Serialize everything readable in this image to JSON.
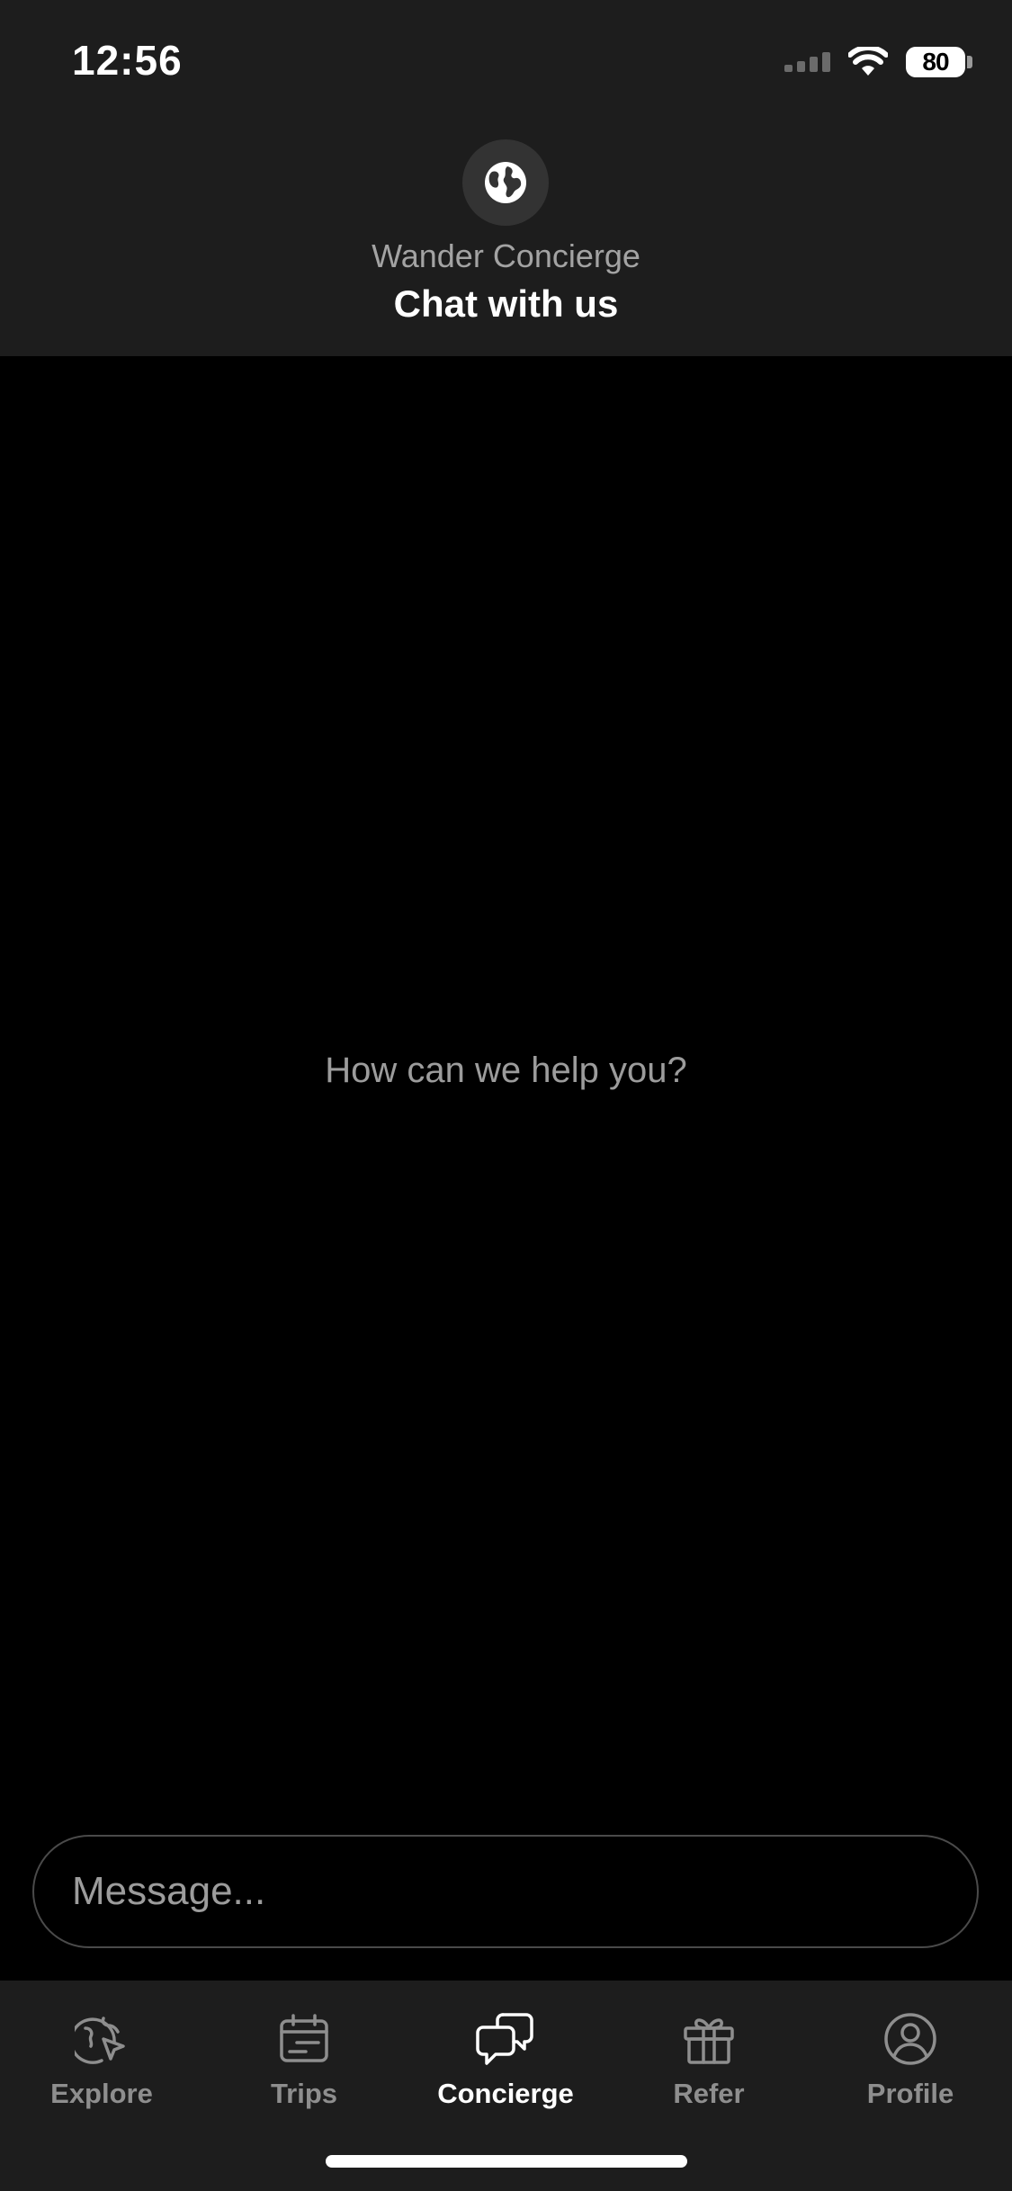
{
  "status_bar": {
    "time": "12:56",
    "battery": "80"
  },
  "header": {
    "avatar_icon": "globe-icon",
    "subtitle": "Wander Concierge",
    "title": "Chat with us"
  },
  "chat": {
    "empty_prompt": "How can we help you?"
  },
  "composer": {
    "placeholder": "Message...",
    "value": ""
  },
  "tabs": [
    {
      "label": "Explore",
      "icon": "globe-cursor-icon",
      "active": false
    },
    {
      "label": "Trips",
      "icon": "calendar-icon",
      "active": false
    },
    {
      "label": "Concierge",
      "icon": "chat-bubbles-icon",
      "active": true
    },
    {
      "label": "Refer",
      "icon": "gift-icon",
      "active": false
    },
    {
      "label": "Profile",
      "icon": "user-circle-icon",
      "active": false
    }
  ],
  "colors": {
    "background": "#000000",
    "surface": "#1d1d1d",
    "muted_text": "#9c9c9c",
    "active_tab": "#ffffff",
    "inactive_tab": "#8e8e8e"
  }
}
